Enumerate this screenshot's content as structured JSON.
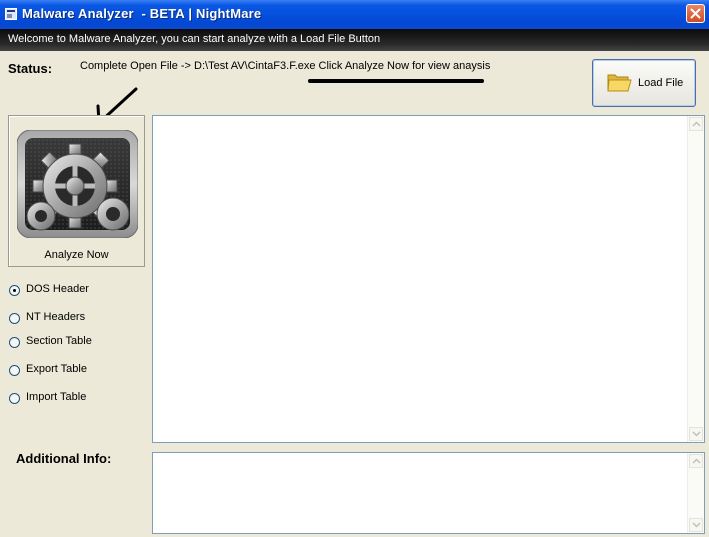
{
  "window": {
    "title": "Malware Analyzer  - BETA | NightMare"
  },
  "welcome_text": "Welcome to Malware Analyzer, you can start analyze with a Load File Button",
  "status": {
    "label": "Status:",
    "message": "Complete Open File -> D:\\Test AV\\CintaF3.F.exe Click Analyze Now for view anaysis"
  },
  "load_button": {
    "label": "Load File",
    "icon": "folder-icon"
  },
  "analyze_button": {
    "label": "Analyze Now",
    "icon": "gear-icon"
  },
  "options": {
    "selected": "DOS Header",
    "items": [
      {
        "label": "DOS Header",
        "checked": true
      },
      {
        "label": "NT Headers",
        "checked": false
      },
      {
        "label": "Section Table",
        "checked": false
      },
      {
        "label": "Export Table",
        "checked": false
      },
      {
        "label": "Import Table",
        "checked": false
      }
    ]
  },
  "additional_info": {
    "label": "Additional Info:"
  },
  "colors": {
    "titlebar": "#0550dc",
    "close_button": "#d24b21",
    "welcome_bar": "#1a1a1a",
    "background": "#ece9d8"
  }
}
